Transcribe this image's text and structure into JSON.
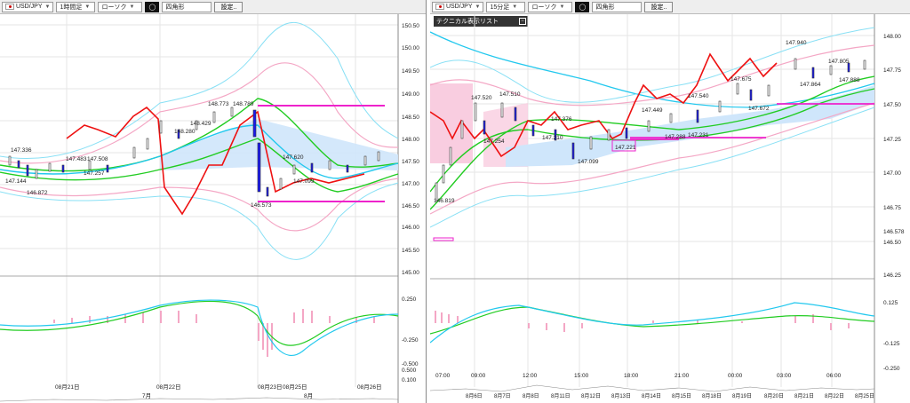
{
  "left": {
    "toolbar": {
      "symbol": "USD/JPY",
      "timeframe": "1時間足",
      "chart_type": "ローソク",
      "tool": "四角形",
      "settings_label": "設定.."
    },
    "price_axis": [
      "150.50",
      "150.00",
      "149.50",
      "149.00",
      "148.50",
      "148.00",
      "147.50",
      "147.00",
      "146.50",
      "146.00",
      "145.50",
      "145.00"
    ],
    "macd_axis": [
      "0.250",
      "-0.250",
      "-0.500",
      "0.500",
      "0.100"
    ],
    "time_axis": [
      "08月21日",
      "08月22日",
      "08月23日",
      "08月25日",
      "08月26日"
    ],
    "month_labels": [
      "7月",
      "8月"
    ],
    "price_labels": [
      "147.336",
      "147.144",
      "146.872",
      "147.483",
      "147.508",
      "147.257",
      "148.280",
      "148.773",
      "148.429",
      "148.789",
      "147.620",
      "147.099",
      "146.573"
    ]
  },
  "right": {
    "toolbar": {
      "symbol": "USD/JPY",
      "timeframe": "15分足",
      "chart_type": "ローソク",
      "tool": "四角形",
      "settings_label": "設定.."
    },
    "popup_title": "テクニカル表示リスト",
    "price_axis": [
      "148.00",
      "147.75",
      "147.50",
      "147.25",
      "147.00",
      "146.75",
      "146.578",
      "146.50",
      "146.25"
    ],
    "macd_axis": [
      "0.125",
      "-0.125",
      "-0.250"
    ],
    "time_axis": [
      "07:00",
      "09:00",
      "12:00",
      "15:00",
      "18:00",
      "21:00",
      "00:00",
      "03:00",
      "06:00"
    ],
    "date_axis": [
      "8月6日",
      "8月7日",
      "8月8日",
      "8月11日",
      "8月12日",
      "8月13日",
      "8月14日",
      "8月15日",
      "8月18日",
      "8月19日",
      "8月20日",
      "8月21日",
      "8月22日",
      "8月25日"
    ],
    "price_labels": [
      "147.520",
      "147.510",
      "147.254",
      "147.376",
      "147.210",
      "147.099",
      "147.221",
      "147.449",
      "147.288",
      "147.540",
      "147.231",
      "147.675",
      "147.672",
      "147.940",
      "147.805",
      "147.864",
      "147.888",
      "146.819"
    ]
  }
}
